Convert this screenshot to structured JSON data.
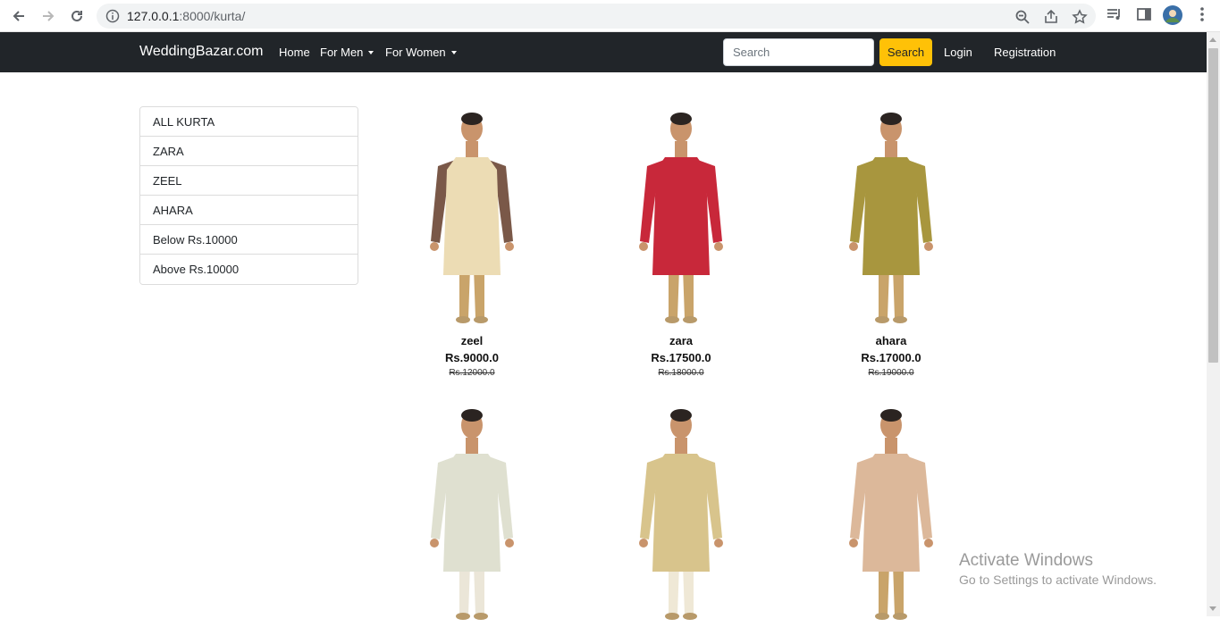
{
  "browser": {
    "url_host": "127.0.0.1",
    "url_rest": ":8000/kurta/"
  },
  "navbar": {
    "brand": "WeddingBazar.com",
    "home": "Home",
    "for_men": "For Men",
    "for_women": "For Women",
    "search_placeholder": "Search",
    "search_button": "Search",
    "login": "Login",
    "registration": "Registration"
  },
  "sidebar": {
    "items": [
      {
        "label": "ALL KURTA"
      },
      {
        "label": "ZARA"
      },
      {
        "label": "ZEEL"
      },
      {
        "label": "AHARA"
      },
      {
        "label": "Below Rs.10000"
      },
      {
        "label": "Above Rs.10000"
      }
    ]
  },
  "products": [
    {
      "name": "zeel",
      "price": "Rs.9000.0",
      "old_price": "Rs.12000.0",
      "colors": {
        "body": "#ecdcb4",
        "sleeve": "#7a5848",
        "pants": "#c9a46a"
      }
    },
    {
      "name": "zara",
      "price": "Rs.17500.0",
      "old_price": "Rs.18000.0",
      "colors": {
        "body": "#c8283a",
        "sleeve": "#c8283a",
        "pants": "#c9a46a"
      }
    },
    {
      "name": "ahara",
      "price": "Rs.17000.0",
      "old_price": "Rs.19000.0",
      "colors": {
        "body": "#a8963e",
        "sleeve": "#a8963e",
        "pants": "#c9a46a"
      }
    },
    {
      "name": "",
      "price": "",
      "old_price": "",
      "colors": {
        "body": "#dfe0d0",
        "sleeve": "#dfe0d0",
        "pants": "#ebe6d8"
      }
    },
    {
      "name": "",
      "price": "",
      "old_price": "",
      "colors": {
        "body": "#d8c48c",
        "sleeve": "#d8c48c",
        "pants": "#efe8d6"
      }
    },
    {
      "name": "",
      "price": "",
      "old_price": "",
      "colors": {
        "body": "#dcb89a",
        "sleeve": "#dcb89a",
        "pants": "#c9a46a"
      }
    }
  ],
  "watermark": {
    "line1": "Activate Windows",
    "line2": "Go to Settings to activate Windows."
  }
}
